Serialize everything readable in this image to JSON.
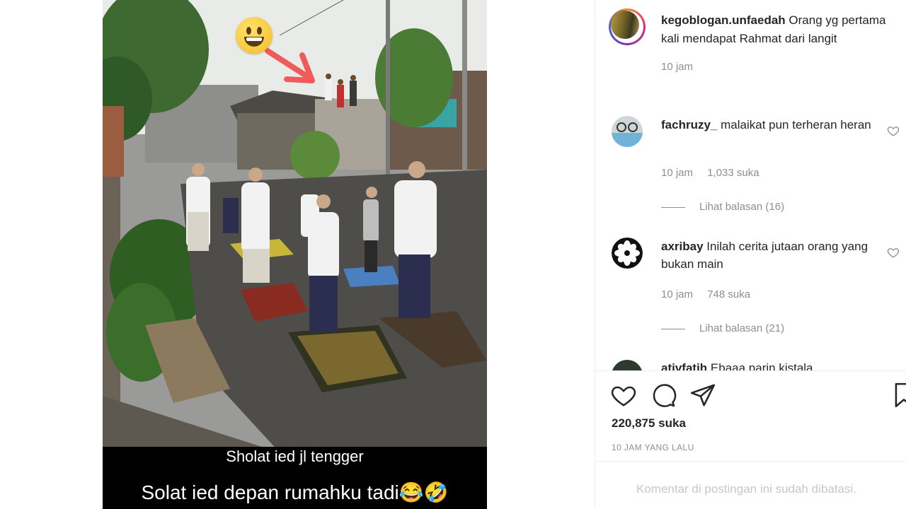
{
  "photo": {
    "caption_line_1": "Sholat ied jl tengger",
    "caption_line_2": "Solat ied depan rumahku tadi😂🤣"
  },
  "post": {
    "author": "kegoblogan.unfaedah",
    "caption": "Orang yg pertama kali mendapat Rahmat dari langit",
    "time": "10 jam"
  },
  "comments": [
    {
      "username": "fachruzy_",
      "text": "malaikat pun terheran heran",
      "time": "10 jam",
      "likes": "1,033 suka",
      "replies": "Lihat balasan (16)"
    },
    {
      "username": "axribay",
      "text": "Inilah cerita jutaan orang yang bukan main",
      "time": "10 jam",
      "likes": "748 suka",
      "replies": "Lihat balasan (21)"
    }
  ],
  "partial_comment": {
    "username": "ativfatih",
    "text": "Ebaaa parin kistala"
  },
  "stats": {
    "likes": "220,875 suka",
    "posted": "10 JAM YANG LALU"
  },
  "footer": {
    "comments_disabled": "Komentar di postingan ini sudah dibatasi."
  },
  "icons": {
    "like": "heart-icon",
    "comment": "comment-bubble-icon",
    "share": "paper-plane-icon",
    "save": "bookmark-icon"
  }
}
